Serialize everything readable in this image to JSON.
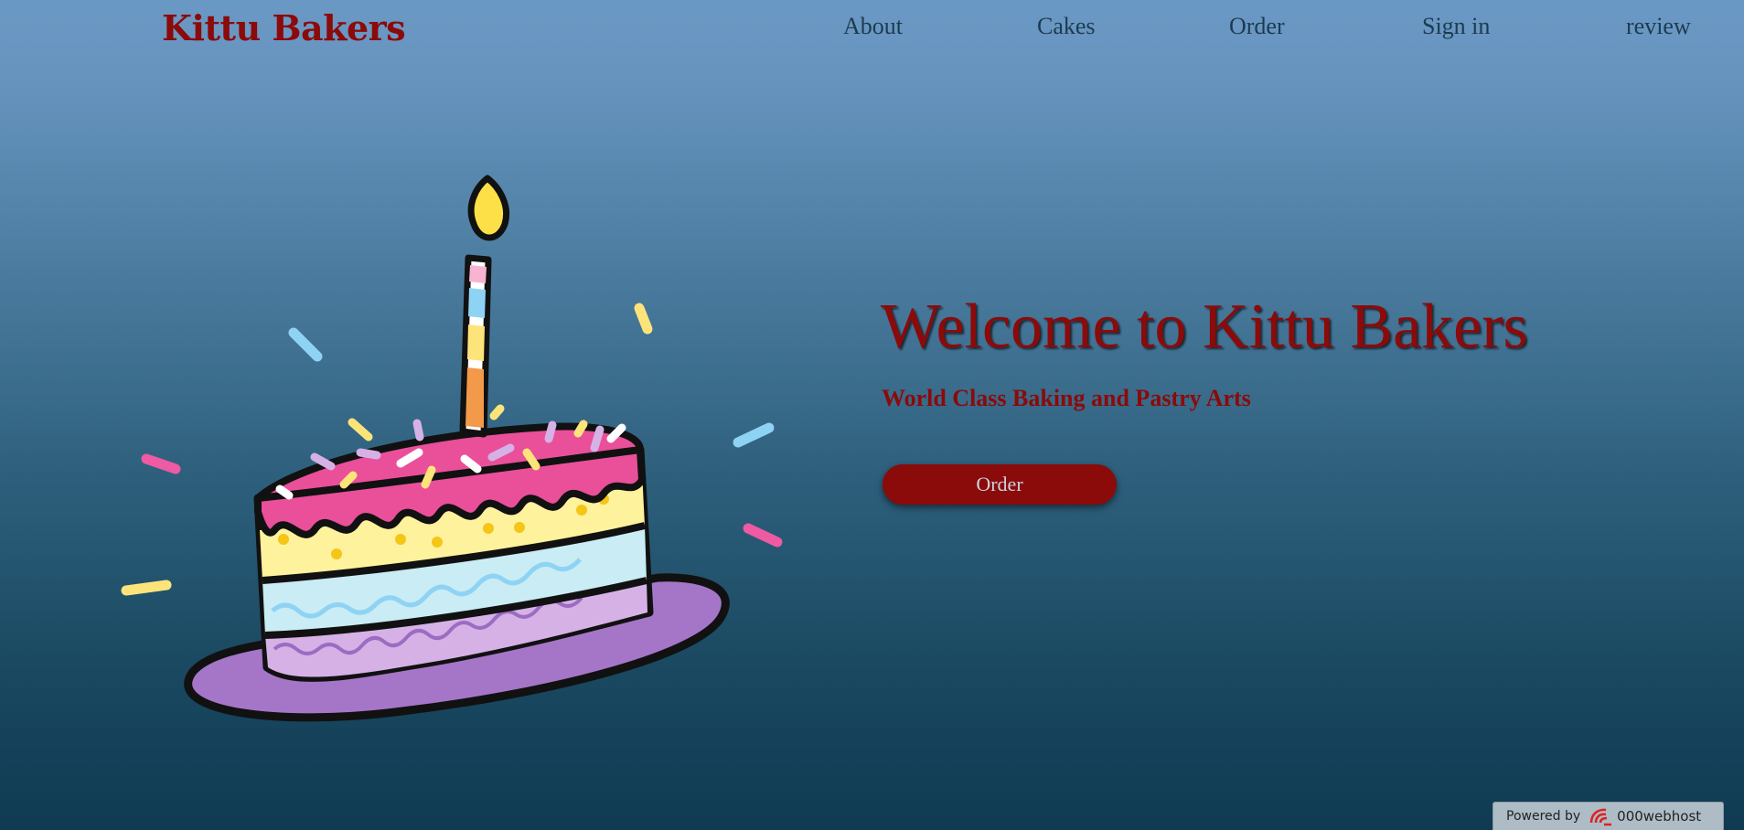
{
  "header": {
    "logo": "Kittu Bakers",
    "nav": [
      "About",
      "Cakes",
      "Order",
      "Sign in",
      "review"
    ]
  },
  "hero": {
    "title": "Welcome to Kittu Bakers",
    "subtitle": "World Class Baking and Pastry Arts",
    "order_button": "Order",
    "image": "birthday-cake-slice-illustration"
  },
  "footer_badge": {
    "powered_by": "Powered by",
    "brand": "000webhost",
    "icon": "000webhost-logo-icon"
  },
  "colors": {
    "brand": "#8b0a0a",
    "nav_text": "#1d3b50",
    "background_top": "#6a98c4",
    "background_bottom": "#0f3a52"
  }
}
